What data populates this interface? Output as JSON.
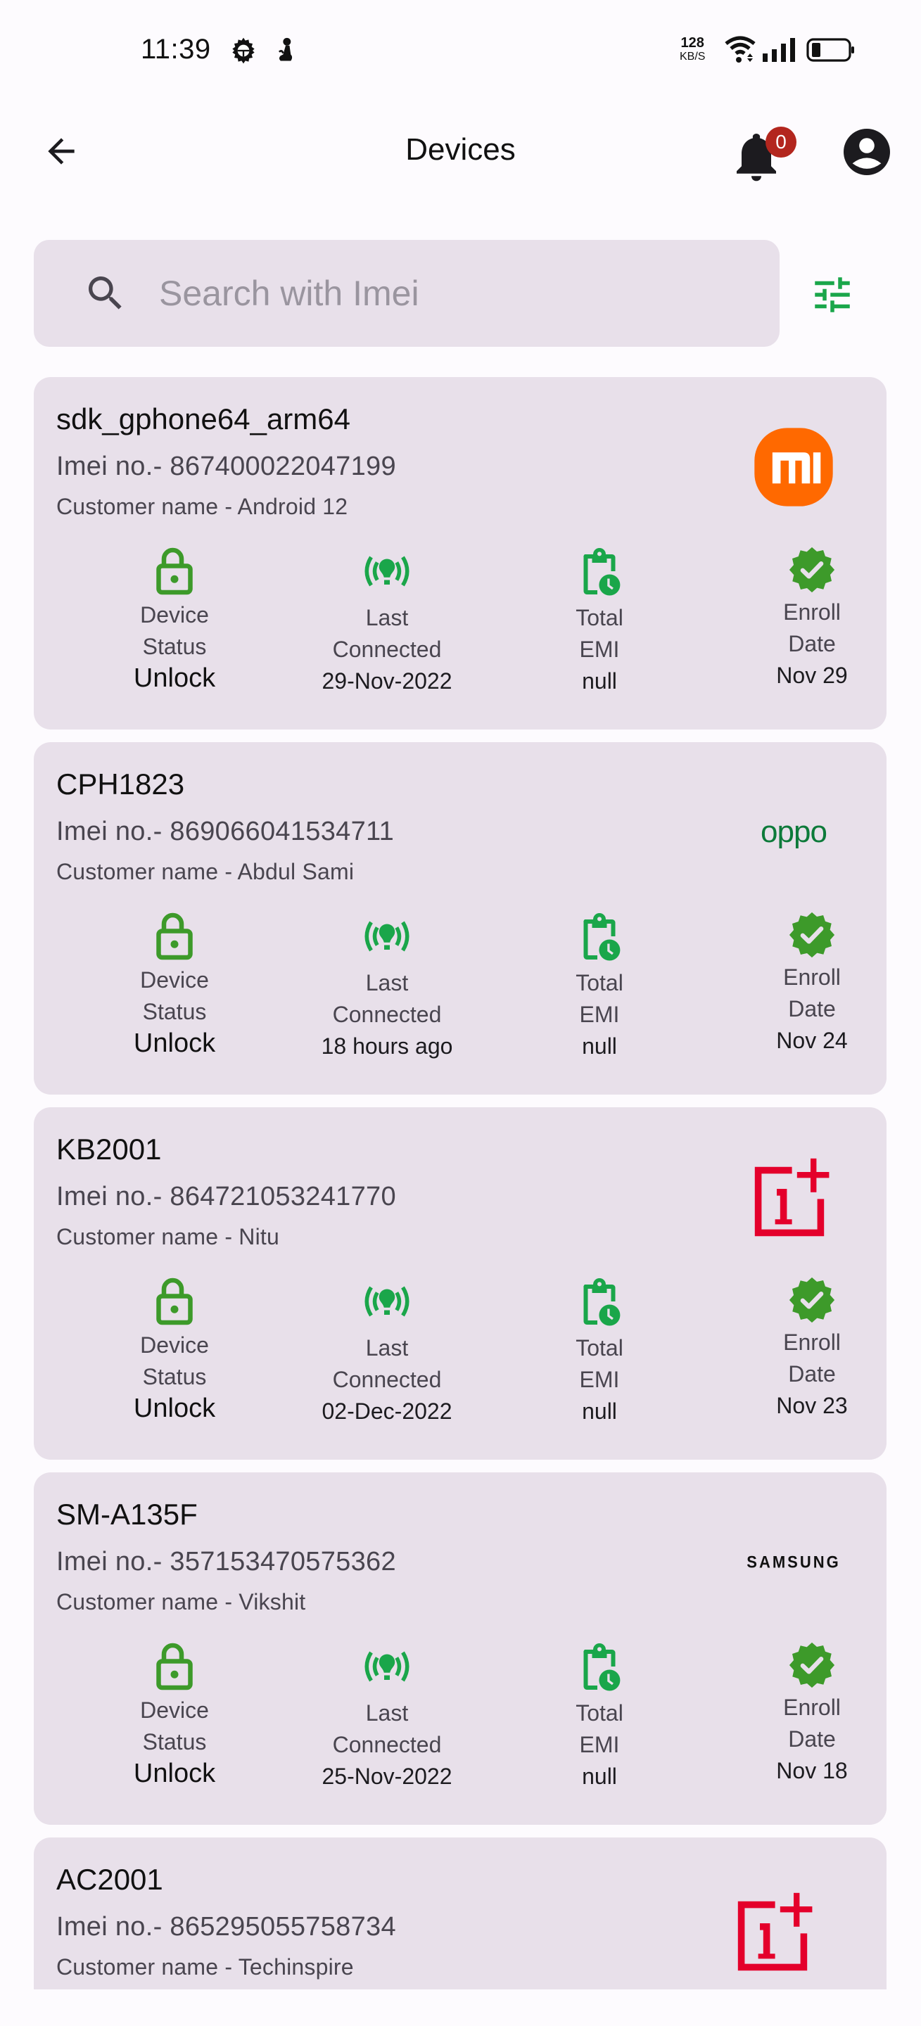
{
  "status_bar": {
    "time": "11:39",
    "net_speed_value": "128",
    "net_speed_unit": "KB/S",
    "icons": [
      "gear-icon",
      "notification-app-icon",
      "wifi-icon",
      "signal-icon",
      "battery-icon"
    ]
  },
  "app_bar": {
    "title": "Devices",
    "back_icon": "arrow-left-icon",
    "notification_count": "0",
    "bell_icon": "bell-icon",
    "profile_icon": "account-circle-icon"
  },
  "search": {
    "placeholder": "Search with Imei",
    "value": "",
    "filter_icon": "tune-icon"
  },
  "labels": {
    "device_status_1": "Device",
    "device_status_2": "Status",
    "last_connected_1": "Last",
    "last_connected_2": "Connected",
    "total_emi_1": "Total",
    "total_emi_2": "EMI",
    "enroll_date_1": "Enroll",
    "enroll_date_2": "Date"
  },
  "colors": {
    "accent_green": "#1aa64a",
    "lock_green": "#3d9a2a",
    "badge_red": "#b3261e",
    "card_bg": "#e8e0ea"
  },
  "devices": [
    {
      "model": "sdk_gphone64_arm64",
      "imei": "Imei no.- 867400022047199",
      "customer": "Customer name - Android 12",
      "brand": "mi",
      "brand_text": "mi",
      "device_status": "Unlock",
      "last_connected": "29-Nov-2022",
      "total_emi": "null",
      "enroll_date": "Nov 29"
    },
    {
      "model": "CPH1823",
      "imei": "Imei no.- 869066041534711",
      "customer": "Customer name - Abdul Sami",
      "brand": "oppo",
      "brand_text": "oppo",
      "device_status": "Unlock",
      "last_connected": "18 hours ago",
      "total_emi": "null",
      "enroll_date": "Nov 24"
    },
    {
      "model": "KB2001",
      "imei": "Imei no.- 864721053241770",
      "customer": "Customer name - Nitu",
      "brand": "oneplus",
      "brand_text": "1+",
      "device_status": "Unlock",
      "last_connected": "02-Dec-2022",
      "total_emi": "null",
      "enroll_date": "Nov 23"
    },
    {
      "model": "SM-A135F",
      "imei": "Imei no.- 357153470575362",
      "customer": "Customer name - Vikshit",
      "brand": "samsung",
      "brand_text": "SAMSUNG",
      "device_status": "Unlock",
      "last_connected": "25-Nov-2022",
      "total_emi": "null",
      "enroll_date": "Nov 18"
    },
    {
      "model": "AC2001",
      "imei": "Imei no.- 865295055758734",
      "customer": "Customer name - Techinspire",
      "brand": "oneplus",
      "brand_text": "1+"
    }
  ]
}
